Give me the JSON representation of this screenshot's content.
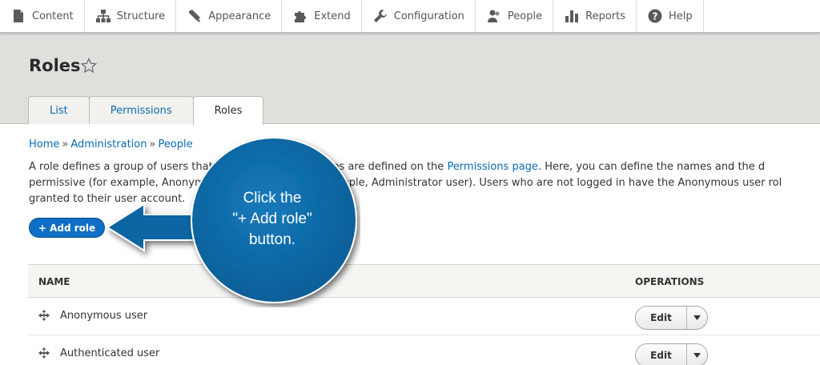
{
  "toolbar": {
    "items": [
      {
        "label": "Content",
        "icon": "document-icon"
      },
      {
        "label": "Structure",
        "icon": "sitemap-icon"
      },
      {
        "label": "Appearance",
        "icon": "paintbrush-icon"
      },
      {
        "label": "Extend",
        "icon": "puzzle-icon"
      },
      {
        "label": "Configuration",
        "icon": "wrench-icon"
      },
      {
        "label": "People",
        "icon": "people-icon"
      },
      {
        "label": "Reports",
        "icon": "bar-chart-icon"
      },
      {
        "label": "Help",
        "icon": "help-icon"
      }
    ]
  },
  "page": {
    "title": "Roles",
    "tabs": [
      {
        "label": "List",
        "active": false
      },
      {
        "label": "Permissions",
        "active": false
      },
      {
        "label": "Roles",
        "active": true
      }
    ]
  },
  "breadcrumb": {
    "items": [
      "Home",
      "Administration",
      "People"
    ],
    "separator": "»"
  },
  "description": {
    "line1_a": "A role defines a group of users that h",
    "line1_b": "These privileges are defined on the",
    "line1_link": "Permissions page",
    "line1_c": ". Here, you can define the names and the d",
    "line2_a": "permissive (for example, Anonym",
    "line2_b": "(for example, Administrator user). Users who are not logged in have the Anonymous user rol",
    "line3": "granted to their user account."
  },
  "add_role_button": "+ Add role",
  "table": {
    "headers": {
      "name": "NAME",
      "operations": "OPERATIONS"
    },
    "rows": [
      {
        "name": "Anonymous user",
        "edit": "Edit"
      },
      {
        "name": "Authenticated user",
        "edit": "Edit"
      }
    ]
  },
  "callout": {
    "line1": "Click the",
    "line2": "\"+ Add role\"",
    "line3": "button.",
    "color": "#0a6aa8"
  },
  "colors": {
    "link": "#0a6bb2",
    "header_bg": "#e0dfdc",
    "primary_button": "#0f6fc6"
  }
}
